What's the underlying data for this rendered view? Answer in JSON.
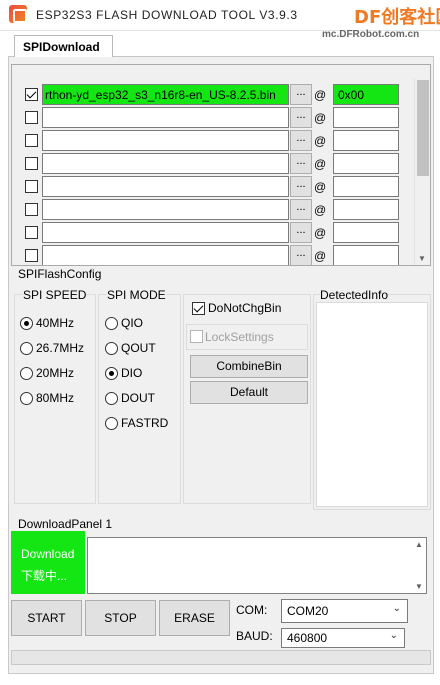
{
  "window": {
    "title": "ESP32S3 FLASH DOWNLOAD TOOL V3.9.3",
    "watermark_logo": "DF创客社区",
    "watermark_url": "mc.DFRobot.com.cn"
  },
  "tabs": [
    {
      "label": "SPIDownload",
      "active": true
    }
  ],
  "file_rows": [
    {
      "checked": true,
      "path": "rthon-yd_esp32_s3_n16r8-en_US-8.2.5.bin",
      "browse": "...",
      "at": "@",
      "address": "0x00",
      "highlight": true
    },
    {
      "checked": false,
      "path": "",
      "browse": "...",
      "at": "@",
      "address": "",
      "highlight": false
    },
    {
      "checked": false,
      "path": "",
      "browse": "...",
      "at": "@",
      "address": "",
      "highlight": false
    },
    {
      "checked": false,
      "path": "",
      "browse": "...",
      "at": "@",
      "address": "",
      "highlight": false
    },
    {
      "checked": false,
      "path": "",
      "browse": "...",
      "at": "@",
      "address": "",
      "highlight": false
    },
    {
      "checked": false,
      "path": "",
      "browse": "...",
      "at": "@",
      "address": "",
      "highlight": false
    },
    {
      "checked": false,
      "path": "",
      "browse": "...",
      "at": "@",
      "address": "",
      "highlight": false
    },
    {
      "checked": false,
      "path": "",
      "browse": "...",
      "at": "@",
      "address": "",
      "highlight": false
    }
  ],
  "flash_config": {
    "title": "SPIFlashConfig",
    "speed": {
      "title": "SPI SPEED",
      "options": [
        {
          "label": "40MHz",
          "selected": true
        },
        {
          "label": "26.7MHz",
          "selected": false
        },
        {
          "label": "20MHz",
          "selected": false
        },
        {
          "label": "80MHz",
          "selected": false
        }
      ]
    },
    "mode": {
      "title": "SPI MODE",
      "options": [
        {
          "label": "QIO",
          "selected": false
        },
        {
          "label": "QOUT",
          "selected": false
        },
        {
          "label": "DIO",
          "selected": true
        },
        {
          "label": "DOUT",
          "selected": false
        },
        {
          "label": "FASTRD",
          "selected": false
        }
      ]
    },
    "do_not_chg_bin": {
      "label": "DoNotChgBin",
      "checked": true
    },
    "lock_settings": {
      "label": "LockSettings",
      "checked": false,
      "disabled": true
    },
    "combine_bin": "CombineBin",
    "default": "Default",
    "detected_info": {
      "title": "DetectedInfo"
    }
  },
  "download_panel": {
    "title": "DownloadPanel 1",
    "status_en": "Download",
    "status_cn": "下载中...",
    "status_color": "#14e614",
    "start": "START",
    "stop": "STOP",
    "erase": "ERASE",
    "com_label": "COM:",
    "com_value": "COM20",
    "baud_label": "BAUD:",
    "baud_value": "460800"
  }
}
